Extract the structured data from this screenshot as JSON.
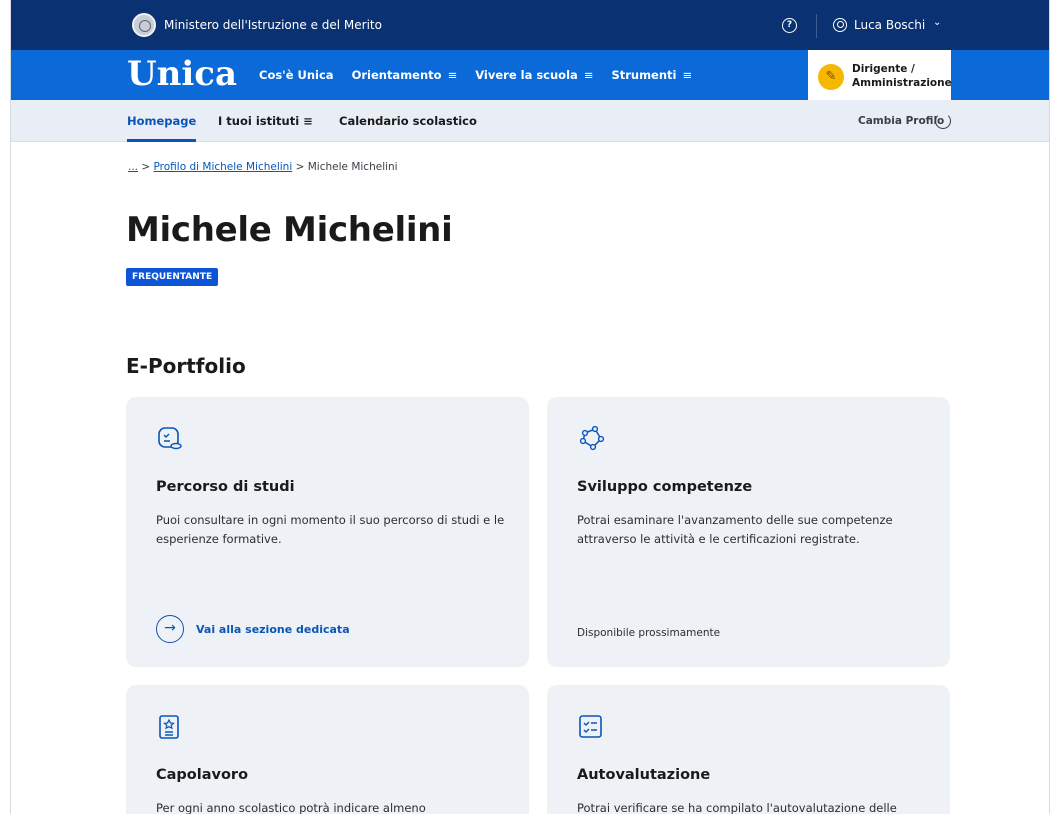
{
  "topbar": {
    "ministry": "Ministero dell'Istruzione e del Merito",
    "help_icon": "?",
    "user_name": "Luca Boschi",
    "chevron": "⌄"
  },
  "nav": {
    "logo": "Unica",
    "items": [
      {
        "label": "Cos'è Unica",
        "menu": ""
      },
      {
        "label": "Orientamento",
        "menu": "≡"
      },
      {
        "label": "Vivere la scuola",
        "menu": "≡"
      },
      {
        "label": "Strumenti",
        "menu": "≡"
      }
    ],
    "role_line1": "Dirigente /",
    "role_line2": "Amministrazione"
  },
  "subnav": {
    "tabs": [
      {
        "label": "Homepage"
      },
      {
        "label": "I tuoi istituti ≡"
      },
      {
        "label": "Calendario scolastico"
      }
    ],
    "cambia": "Cambia Profilo"
  },
  "breadcrumb": {
    "dots": "...",
    "sep": ">",
    "link": "Profilo di Michele Michelini",
    "current": "Michele Michelini"
  },
  "page": {
    "title": "Michele Michelini",
    "status": "FREQUENTANTE",
    "section": "E-Portfolio"
  },
  "cards": [
    {
      "title": "Percorso di studi",
      "desc": "Puoi consultare in ogni momento il suo percorso di studi e le esperienze formative.",
      "link": "Vai alla sezione dedicata",
      "icon": "study-path-icon"
    },
    {
      "title": "Sviluppo competenze",
      "desc": "Potrai esaminare l'avanzamento delle sue competenze attraverso le attività e le certificazioni registrate.",
      "note": "Disponibile prossimamente",
      "icon": "competences-icon"
    },
    {
      "title": "Capolavoro",
      "desc": "Per ogni anno scolastico potrà indicare almeno",
      "icon": "masterpiece-icon"
    },
    {
      "title": "Autovalutazione",
      "desc": "Potrai verificare se ha compilato l'autovalutazione delle",
      "icon": "self-assessment-icon"
    }
  ],
  "colors": {
    "topbar": "#0a3172",
    "nav": "#0b6ad8",
    "subnav": "#e9eef6",
    "accent": "#0b55b8",
    "badge": "#f5b700",
    "card": "#eef1f5"
  }
}
